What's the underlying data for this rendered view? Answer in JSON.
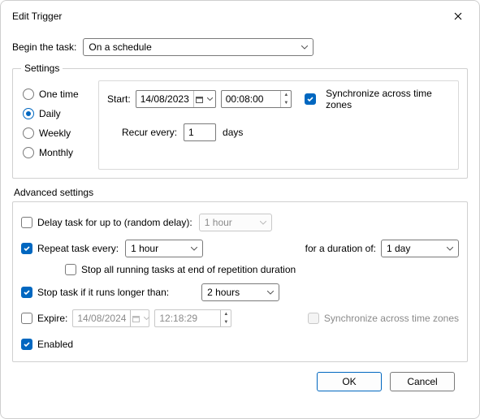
{
  "window": {
    "title": "Edit Trigger"
  },
  "begin": {
    "label": "Begin the task:",
    "value": "On a schedule"
  },
  "settings": {
    "legend": "Settings",
    "freq": {
      "one_time": "One time",
      "daily": "Daily",
      "weekly": "Weekly",
      "monthly": "Monthly",
      "selected": "daily"
    },
    "start_label": "Start:",
    "start_date": "14/08/2023",
    "start_time": "00:08:00",
    "sync_label": "Synchronize across time zones",
    "recur_label": "Recur every:",
    "recur_value": "1",
    "recur_unit": "days"
  },
  "advanced": {
    "legend": "Advanced settings",
    "delay_label": "Delay task for up to (random delay):",
    "delay_value": "1 hour",
    "repeat_label": "Repeat task every:",
    "repeat_value": "1 hour",
    "duration_label": "for a duration of:",
    "duration_value": "1 day",
    "stop_all_label": "Stop all running tasks at end of repetition duration",
    "stop_if_label": "Stop task if it runs longer than:",
    "stop_if_value": "2 hours",
    "expire_label": "Expire:",
    "expire_date": "14/08/2024",
    "expire_time": "12:18:29",
    "expire_sync_label": "Synchronize across time zones",
    "enabled_label": "Enabled"
  },
  "buttons": {
    "ok": "OK",
    "cancel": "Cancel"
  }
}
